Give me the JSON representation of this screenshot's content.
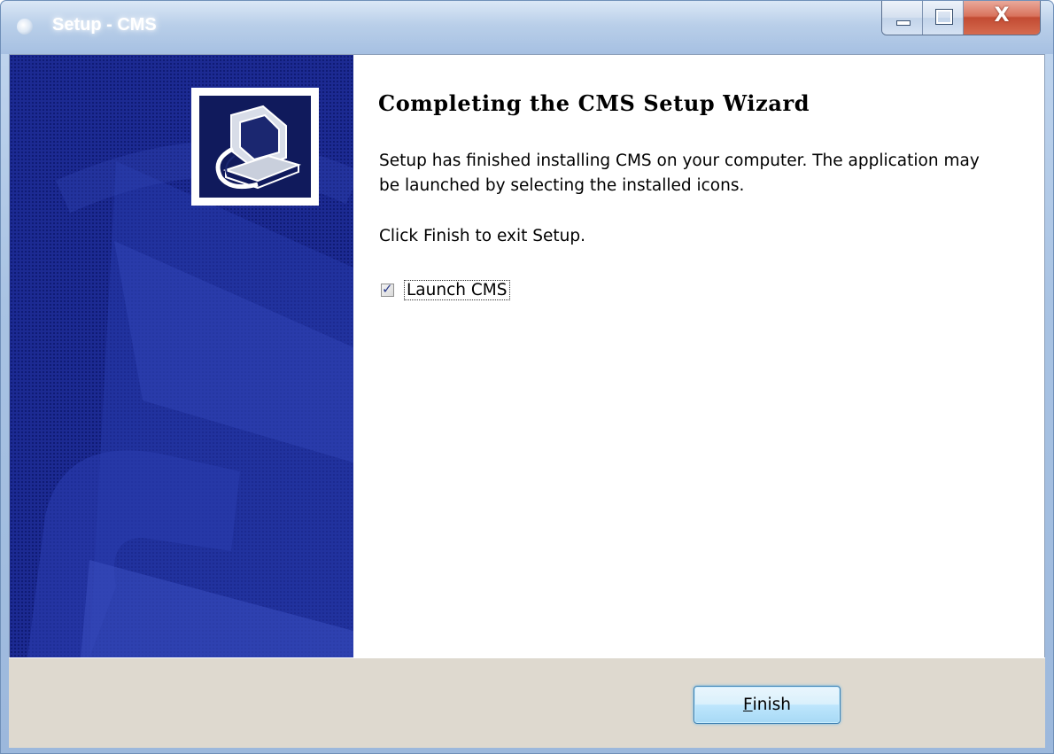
{
  "window": {
    "title": "Setup - CMS",
    "controls": {
      "minimize": "minimize-icon",
      "maximize": "maximize-icon",
      "close_glyph": "X"
    }
  },
  "sidebar": {
    "logo": "computer-install-icon",
    "colors": {
      "background": "#1c2a92",
      "dots": "#0e1a73"
    }
  },
  "content": {
    "heading": "Completing the CMS Setup Wizard",
    "body": "Setup has finished installing CMS on your computer. The application may be launched by selecting the installed icons.",
    "instruction": "Click Finish to exit Setup.",
    "launch_checkbox": {
      "label": "Launch CMS",
      "checked": true,
      "mark": "✓"
    }
  },
  "footer": {
    "finish_button": {
      "accesskey": "F",
      "label_rest": "inish"
    }
  }
}
